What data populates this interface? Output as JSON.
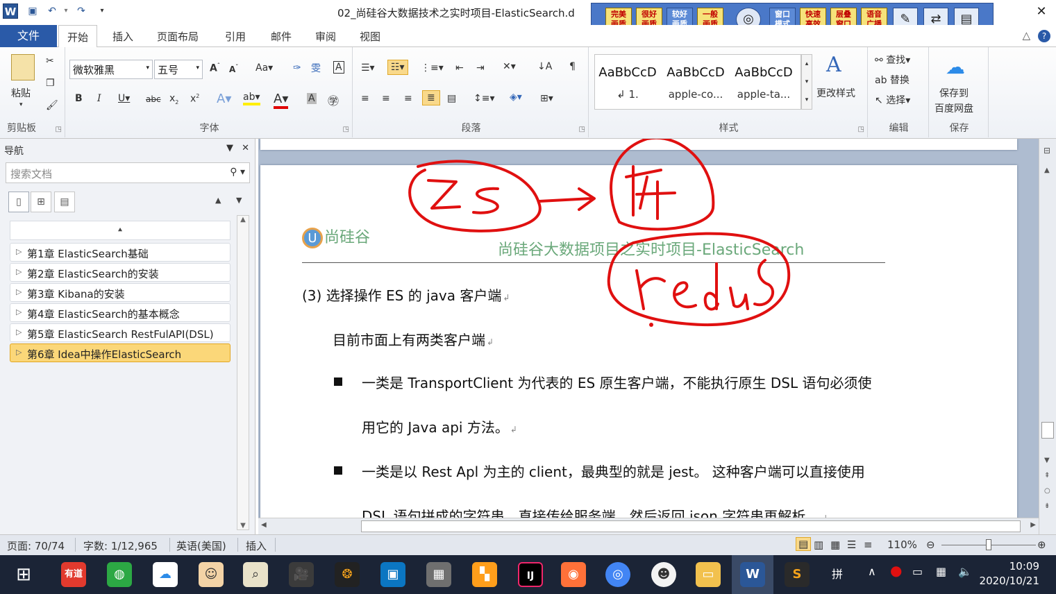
{
  "window": {
    "title": "02_尚硅谷大数据技术之实时项目-ElasticSearch.d",
    "app_icon": "W"
  },
  "recorder_bar": {
    "buttons": [
      "完美\n画质",
      "很好\n画质",
      "较好\n画质",
      "一般\n画质",
      "窗口\n模式",
      "快速\n高效",
      "层叠\n窗口",
      "语音\n广播"
    ]
  },
  "tabs": {
    "file": "文件",
    "items": [
      "开始",
      "插入",
      "页面布局",
      "引用",
      "邮件",
      "审阅",
      "视图"
    ]
  },
  "ribbon": {
    "clipboard": {
      "paste": "粘贴",
      "label": "剪贴板"
    },
    "font": {
      "name": "微软雅黑",
      "size": "五号",
      "label": "字体"
    },
    "paragraph": {
      "label": "段落"
    },
    "styles": {
      "label": "样式",
      "items": [
        {
          "preview": "AaBbCcD",
          "name": "↲ 1."
        },
        {
          "preview": "AaBbCcD",
          "name": "apple-co..."
        },
        {
          "preview": "AaBbCcD",
          "name": "apple-ta..."
        }
      ],
      "change_styles": "更改样式"
    },
    "editing": {
      "label": "编辑",
      "find": "查找",
      "replace": "替换",
      "select": "选择"
    },
    "save": {
      "label": "保存",
      "button": "保存到\n百度网盘"
    }
  },
  "nav": {
    "title": "导航",
    "search_placeholder": "搜索文档",
    "items": [
      "第1章 ElasticSearch基础",
      "第2章 ElasticSearch的安装",
      "第3章 Kibana的安装",
      "第4章 ElasticSearch的基本概念",
      "第5章 ElasticSearch RestFulAPI(DSL)",
      "第6章 Idea中操作ElasticSearch"
    ],
    "active_index": 5
  },
  "document": {
    "logo_text": "尚硅谷",
    "header_title": "尚硅谷大数据项目之实时项目-ElasticSearch",
    "lines": [
      "(3)   选择操作 ES 的 java 客户端",
      "目前市面上有两类客户端",
      "一类是 TransportClient  为代表的 ES 原生客户端，不能执行原生 DSL 语句必须使",
      "用它的 Java api 方法。",
      "一类是以 Rest Apl 为主的 client，最典型的就是 jest。  这种客户端可以直接使用",
      "DSL 语句拼成的字符串，直接传给服务端，然后返回 json 字符串再解析。"
    ],
    "annotation_color": "#e01010"
  },
  "status": {
    "page": "页面: 70/74",
    "words": "字数: 1/12,965",
    "lang": "英语(美国)",
    "mode": "插入",
    "zoom": "110%"
  },
  "taskbar": {
    "time": "10:09",
    "date": "2020/10/21",
    "ime": "拼"
  }
}
